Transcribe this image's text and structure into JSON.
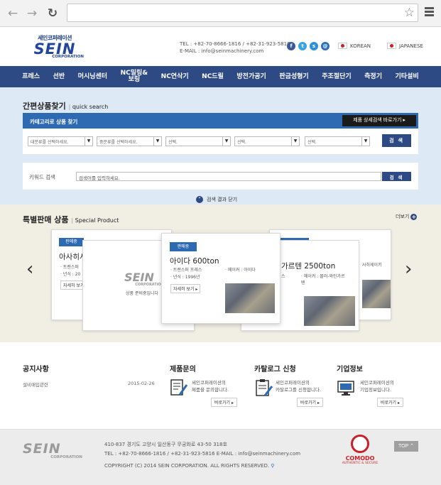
{
  "colors": {
    "nav": "#2e4a85",
    "accent": "#2e6ab1",
    "quicksearch_bg": "#dde9f4",
    "special_bg": "#f1eee4"
  },
  "browser": {
    "back_icon": "arrow-left-icon",
    "forward_icon": "arrow-right-icon",
    "reload_icon": "reload-icon",
    "star_icon": "star-icon",
    "menu_icon": "hamburger-menu-icon",
    "address": ""
  },
  "header": {
    "logo_kr": "세인코퍼레이션",
    "logo_main": "SEIN",
    "logo_sub": "CORPORATION",
    "tel": "TEL : +82-70-8666-1816 / +82-31-923-5816",
    "email": "E-MAIL : info@seinmachinery.com",
    "lang_korean": "KOREAN",
    "lang_japanese": "JAPANESE"
  },
  "nav": [
    "프레스",
    "선반",
    "머시닝센터",
    "NC밀링&\n보링",
    "NC연삭기",
    "NC드릴",
    "방전가공기",
    "판금성형기",
    "주조절단기",
    "측정기",
    "기타설비"
  ],
  "quick_search": {
    "title": "간편상품찾기",
    "subtitle": "quick search",
    "category_label": "카테고리로 상품 찾기",
    "detail_button": "제품 상세검색 바로가기 ▸",
    "select1": "대분류를 선택하세요.",
    "select2": "중분류를 선택하세요.",
    "select3": "선택.",
    "select4": "선택.",
    "select5": "선택.",
    "search_button": "검 색",
    "keyword_label": "키워드 검색",
    "keyword_placeholder": "검색어를 입력하세요.",
    "keyword_button": "검 색",
    "close_label": "검색 결과 닫기"
  },
  "special": {
    "title": "특별판매 상품",
    "subtitle": "Special Product",
    "more": "더보기",
    "cards": {
      "back_left": {
        "badge": "판매중",
        "title": "아사히서",
        "info1": "· 트랜스퍼",
        "info2": "· 년식 : 20",
        "btn": "자세히 보기"
      },
      "mid_left": {
        "logo": "SEIN",
        "logo_sub": "CORPORATION",
        "text": "상품 준비중입니다"
      },
      "center": {
        "badge": "판매중",
        "title": "아이다 600ton",
        "info1": "· 트랜스퍼 프레스",
        "maker": "· 메이커 : 아이다",
        "info2": "· 년식 : 1996년",
        "btn": "자세히 보기 ▸"
      },
      "mid_right": {
        "title": "가르텐 2500ton",
        "info1": "스",
        "maker": "· 메이커 : 몰러-와인가르",
        "maker2": "텐"
      },
      "back_right": {
        "info": "사히세이키"
      }
    }
  },
  "bottom": {
    "notice_title": "공지사항",
    "notice_item": "설비매입관련",
    "notice_date": "2015-02-26",
    "inquiry_title": "제품문의",
    "inquiry_text1": "세인코퍼레이션의",
    "inquiry_text2": "제품을 문의합니다.",
    "catalog_title": "카탈로그 신청",
    "catalog_text1": "세인코퍼레이션의",
    "catalog_text2": "카탈로그를 신청합니다.",
    "company_title": "기업정보",
    "company_text1": "세인코퍼레이션의",
    "company_text2": "기업정보입니다.",
    "shortcut": "바로가기 ▸"
  },
  "footer": {
    "logo_main": "SEIN",
    "logo_sub": "CORPORATION",
    "address": "410-837 경기도 고양시 일산동구 무궁화로 43-50 318호",
    "tel": "TEL : +82-70-8666-1816 / +82-31-923-5816    E-MAIL : info@seinmachinery.com",
    "copyright": "COPYRIGHT (C) 2014 SEIN CORPORATION. ALL RIGHTS RESERVED.",
    "comodo": "COMODO",
    "comodo_sub": "AUTHENTIC & SECURE",
    "top": "TOP ⌃"
  }
}
